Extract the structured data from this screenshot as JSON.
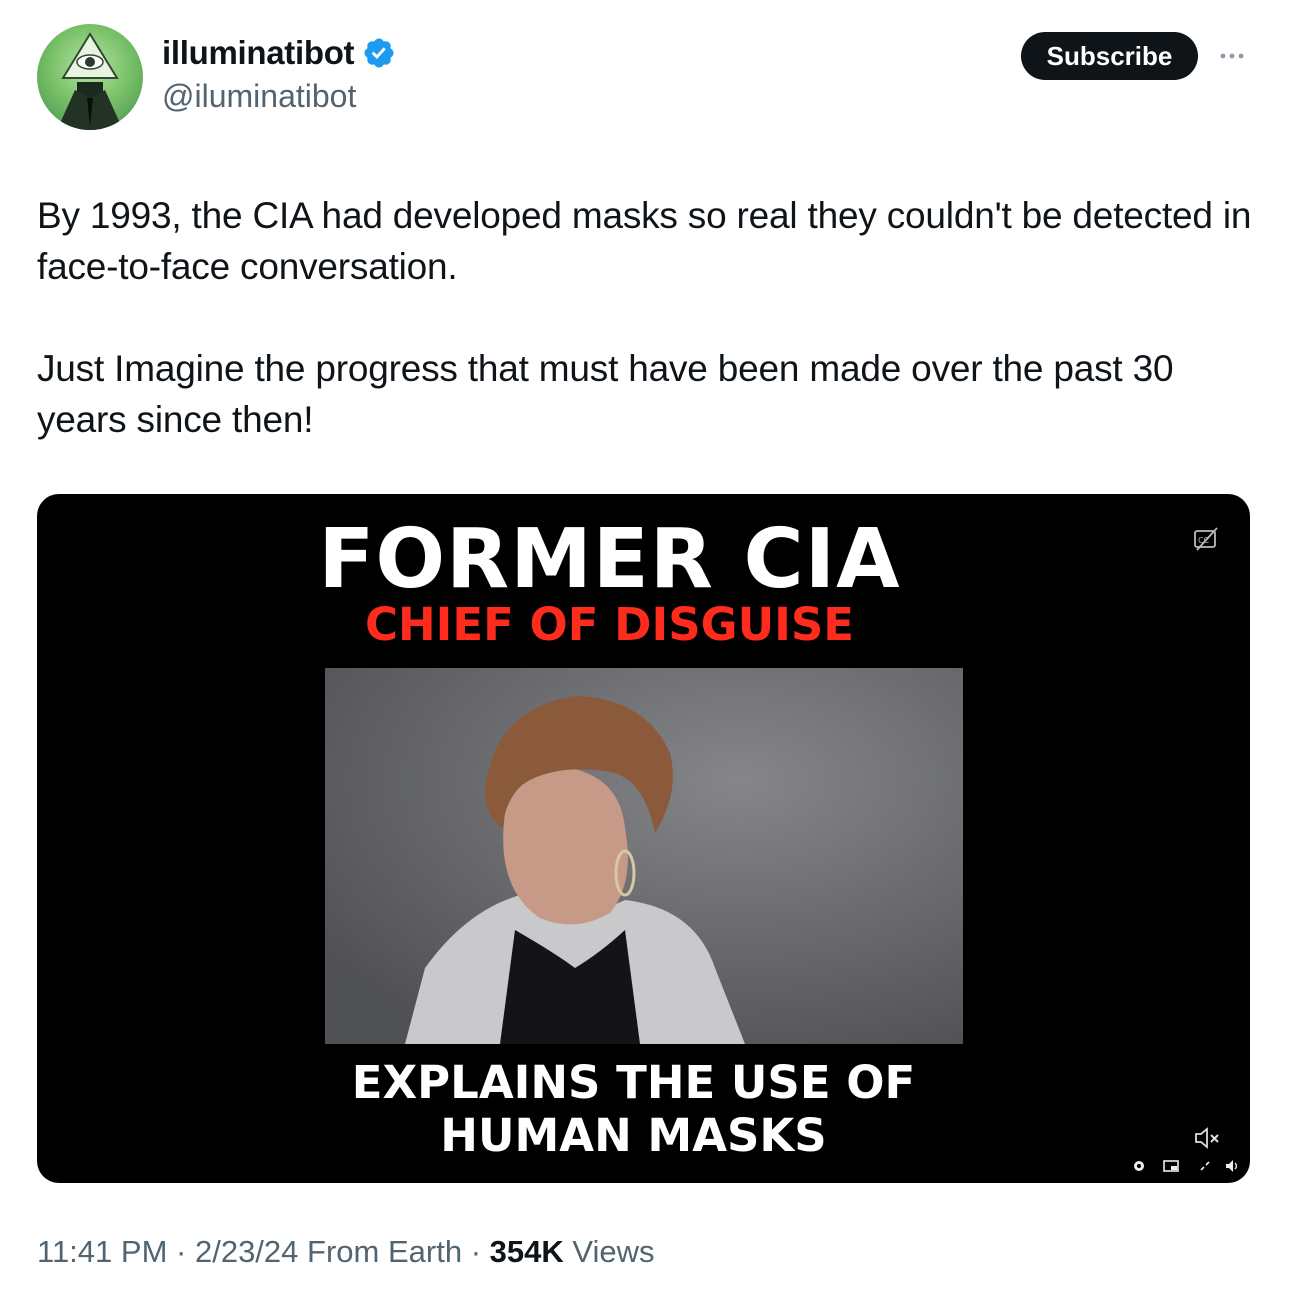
{
  "author": {
    "display_name": "illuminatibot",
    "handle": "@iluminatibot",
    "verified": true
  },
  "actions": {
    "subscribe_label": "Subscribe",
    "more_icon": "more-icon"
  },
  "tweet": {
    "paragraphs": [
      "By 1993, the CIA had developed masks so real they couldn't be detected in face-to-face conversation.",
      "Just Imagine the progress that must have been made over the past 30 years since then!"
    ]
  },
  "media": {
    "headline_line1": "FORMER CIA",
    "headline_line2": "CHIEF OF DISGUISE",
    "caption_line1": "EXPLAINS THE USE OF",
    "caption_line2": "HUMAN MASKS",
    "icons": [
      "captions-icon",
      "muted-speaker-icon",
      "settings-icon",
      "pip-icon",
      "fullscreen-icon",
      "volume-icon"
    ]
  },
  "meta": {
    "time": "11:41 PM",
    "date": "2/23/24",
    "source": "From Earth",
    "views_count": "354K",
    "views_label": "Views",
    "separator": "·"
  },
  "colors": {
    "text": "#0f1419",
    "secondary": "#536471",
    "verified": "#1d9bf0",
    "headline_red": "#ff2b1c"
  }
}
